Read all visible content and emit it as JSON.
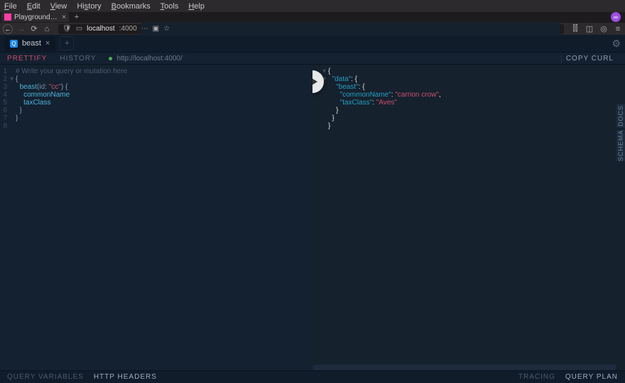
{
  "menubar": {
    "items": [
      "File",
      "Edit",
      "View",
      "History",
      "Bookmarks",
      "Tools",
      "Help"
    ]
  },
  "browser": {
    "tab_title": "Playground – http://local…",
    "url_prefix": "localhost",
    "url_suffix": ":4000"
  },
  "playground": {
    "tab_name": "beast",
    "toolbar": {
      "prettify": "PRETTIFY",
      "history": "HISTORY",
      "endpoint": "http://localhost:4000/",
      "copy": "COPY CURL"
    },
    "sidetabs": {
      "docs": "DOCS",
      "schema": "SCHEMA"
    },
    "footer": {
      "vars": "QUERY VARIABLES",
      "headers": "HTTP HEADERS",
      "tracing": "TRACING",
      "plan": "QUERY PLAN"
    }
  },
  "query": {
    "comment": "# Write your query or mutation here",
    "root": "beast",
    "arg_name": "id",
    "arg_val": "\"cc\"",
    "fields": [
      "commonName",
      "taxClass"
    ]
  },
  "response": {
    "data_key": "\"data\"",
    "beast_key": "\"beast\"",
    "commonName_key": "\"commonName\"",
    "commonName_val": "\"carrion crow\"",
    "taxClass_key": "\"taxClass\"",
    "taxClass_val": "\"Aves\""
  }
}
